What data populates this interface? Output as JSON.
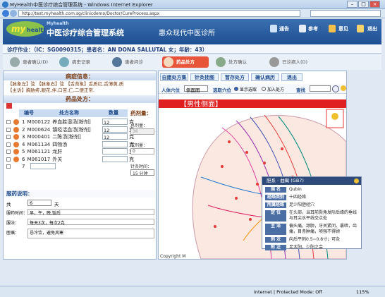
{
  "window": {
    "title": "MyHealth中医诊疗综合管理系统 - Windows Internet Explorer",
    "url": "http://test.myhealth.com.sg/clinicdemo/Doctor/CureProcess.aspx"
  },
  "header": {
    "logo_text": "Myhealth",
    "logo_sub": "www.myhealth.com.sg",
    "app_name": "中医诊疗综合管理系统",
    "app_sub": "Myhealth",
    "center_text": "惠众现代中医诊所",
    "buttons": [
      {
        "label": "通告"
      },
      {
        "label": "参考"
      },
      {
        "label": "意见"
      },
      {
        "label": "退出"
      }
    ]
  },
  "patient": {
    "line": "诊疗作业：（IC：SG0090315；患者名：AN DONA SALLUTAL 女；年龄：43）"
  },
  "steps": [
    {
      "label": "患者确认(D)"
    },
    {
      "label": "病史记录"
    },
    {
      "label": "患者问诊"
    },
    {
      "label": "药品处方"
    },
    {
      "label": "处方确认"
    },
    {
      "label": "已诊病人(D)"
    }
  ],
  "left": {
    "diag_title": "病症信息：",
    "diag_lines": [
      "【脉象左】弦 【脉象右】弦 【舌苔象】舌质红,舌薄黄,质",
      "【主诉】胸胁疼,眼花,伴,口苦,仁,二便正常."
    ],
    "rx_title": "药品处方：",
    "cols": {
      "num": "编号",
      "name": "处方名称",
      "qty": "数量",
      "dose": "药剂量："
    },
    "rows": [
      {
        "idx": "1",
        "code": "M000122",
        "name": "养血胜湿汤[粉剂]",
        "qty": "12",
        "unit": "克"
      },
      {
        "idx": "2",
        "code": "M000624",
        "name": "镇经活血汤[粉剂]",
        "qty": "12",
        "unit": "克"
      },
      {
        "idx": "3",
        "code": "M000401",
        "name": "二陈汤[粉剂]",
        "qty": "12",
        "unit": "克"
      },
      {
        "idx": "4",
        "code": "M061134",
        "name": "四物汤",
        "qty": "",
        "unit": "克"
      },
      {
        "idx": "5",
        "code": "M061121",
        "name": "龙肝",
        "qty": "",
        "unit": "克"
      },
      {
        "idx": "6",
        "code": "M061017",
        "name": "外关",
        "qty": "",
        "unit": "克"
      },
      {
        "idx": "7",
        "code": "",
        "name": "",
        "qty": "",
        "unit": ""
      }
    ],
    "side": {
      "total_label": "总剂量：",
      "total_value": "36",
      "cheng_label": "成剂量：",
      "cheng_value": "0",
      "time_label": "针灸时间：",
      "time_value": "15 分钟"
    },
    "fuyao_title": "服药说明：",
    "fuyao": {
      "days_label": "共",
      "days_value": "6",
      "days_unit": "天",
      "time_label": "服药时间：",
      "time_value": "早，午，晚,饭后",
      "times_label": "服法：",
      "times_value": "每天3次，每次2克",
      "note_label": "医嘱：",
      "note_value": "忌冷饮，避免风寒"
    }
  },
  "right": {
    "tabs": [
      {
        "label": "自建处方集"
      },
      {
        "label": "针灸挂图"
      },
      {
        "label": "暂存处方"
      },
      {
        "label": "确认病历"
      },
      {
        "label": "退出"
      }
    ],
    "body_part_label": "人体穴位",
    "body_part_value": "侧面图",
    "select_label": "选取穴位",
    "radio1": "显示选取",
    "radio2": "加入处方",
    "search_label": "查找",
    "chart_title": "【男性侧面】",
    "copyright": "Copyright M"
  },
  "popup": {
    "title": "胆系 · 曲鬓 (GB7)",
    "rows": [
      {
        "k": "国 名",
        "v": "Qubin"
      },
      {
        "k": "经络类别",
        "v": "十四经络"
      },
      {
        "k": "所属经络",
        "v": "足少阳胆经穴"
      },
      {
        "k": "定 位",
        "v": "在头部，当耳前鬓角发际后缘的垂线与耳尖水平线交点处"
      },
      {
        "k": "主 治",
        "v": "偏头痛，颔肿，牙关紧闭，暴喑，齿痛，目赤肿痛，项强不得顾"
      },
      {
        "k": "刺 法",
        "v": "向后平刺0.5~0.8寸；可灸"
      },
      {
        "k": "附 注",
        "v": "足太阳，少阳之会"
      }
    ]
  },
  "status": {
    "zone": "Internet | Protected Mode: Off",
    "zoom": "115%"
  }
}
